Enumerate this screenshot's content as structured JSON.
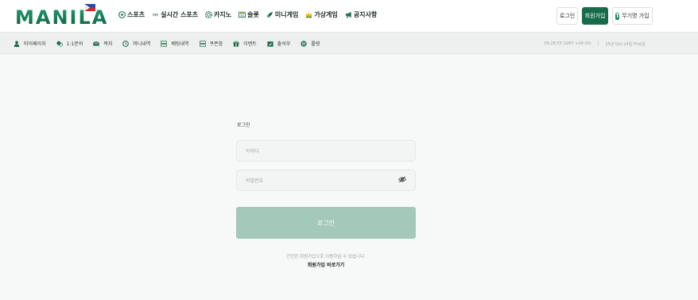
{
  "brand": {
    "logo_text": "MANILA"
  },
  "nav": {
    "items": [
      {
        "label": "스포츠",
        "icon": "soccer-ball-icon"
      },
      {
        "label": "실시간 스포츠",
        "icon": "live-broadcast-icon"
      },
      {
        "label": "카지노",
        "icon": "casino-chip-icon"
      },
      {
        "label": "슬롯",
        "icon": "slot-machine-icon"
      },
      {
        "label": "미니게임",
        "icon": "rocket-icon"
      },
      {
        "label": "가상게임",
        "icon": "crown-icon"
      },
      {
        "label": "공지사항",
        "icon": "megaphone-icon"
      }
    ]
  },
  "auth": {
    "login_label": "로그인",
    "join_label": "회원가입",
    "free_join_label": "무기명 가입"
  },
  "subnav": {
    "items": [
      {
        "label": "마이페이지",
        "icon": "user-icon"
      },
      {
        "label": "1:1문의",
        "icon": "chat-icon"
      },
      {
        "label": "쪽지",
        "icon": "mail-icon"
      },
      {
        "label": "머니내역",
        "icon": "clock-icon"
      },
      {
        "label": "배팅내역",
        "icon": "list-icon"
      },
      {
        "label": "쿠폰함",
        "icon": "coupon-icon"
      },
      {
        "label": "이벤트",
        "icon": "gift-icon"
      },
      {
        "label": "출석부",
        "icon": "calendar-check-icon"
      },
      {
        "label": "룰렛",
        "icon": "roulette-icon"
      }
    ],
    "time": "09:28:55 (GMT +09:00)",
    "date": "25년 Oct 24일 Fri요일"
  },
  "login": {
    "title": "로그인",
    "id_placeholder": "아이디",
    "pw_placeholder": "비밀번호",
    "submit_label": "로그인",
    "hint": "간단한 회원가입으로 이용하실 수 있습니다.",
    "signup_link": "회원가입 바로가기"
  },
  "colors": {
    "brand_green": "#166b4c",
    "button_disabled": "#a4c9bb"
  }
}
